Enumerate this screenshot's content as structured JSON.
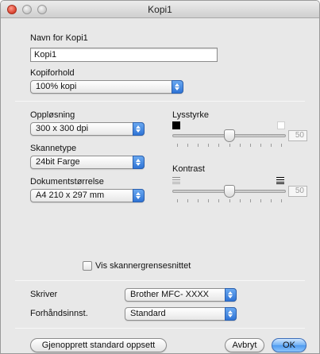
{
  "window": {
    "title": "Kopi1"
  },
  "name_field": {
    "label": "Navn for Kopi1",
    "value": "Kopi1"
  },
  "copy_ratio": {
    "label": "Kopiforhold",
    "value": "100% kopi"
  },
  "resolution": {
    "label": "Oppløsning",
    "value": "300 x 300 dpi"
  },
  "scan_type": {
    "label": "Skannetype",
    "value": "24bit Farge"
  },
  "document_size": {
    "label": "Dokumentstørrelse",
    "value": "A4  210 x 297 mm"
  },
  "brightness": {
    "label": "Lysstyrke",
    "value": "50"
  },
  "contrast": {
    "label": "Kontrast",
    "value": "50"
  },
  "scanner_interface": {
    "label": "Vis skannergrensesnittet",
    "checked": false
  },
  "printer": {
    "label": "Skriver",
    "value": "Brother MFC- XXXX"
  },
  "preset": {
    "label": "Forhåndsinnst.",
    "value": "Standard"
  },
  "buttons": {
    "restore_defaults": "Gjenopprett standard oppsett",
    "cancel": "Avbryt",
    "ok": "OK"
  },
  "colors": {
    "accent": "#4f9bf0",
    "close_button": "#d8402e"
  }
}
